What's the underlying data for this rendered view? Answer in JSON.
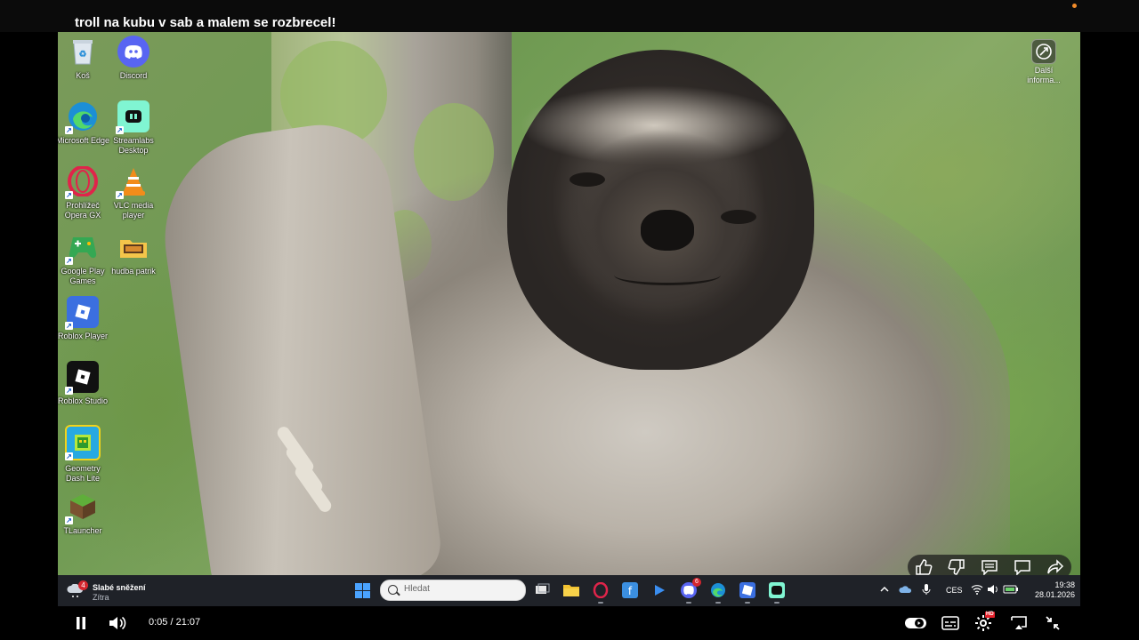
{
  "video": {
    "title": "troll na kubu v sab a malem se rozbrecel!"
  },
  "desktop": {
    "icons": [
      {
        "label": "Koš",
        "icon": "recycle-bin-icon"
      },
      {
        "label": "Discord",
        "icon": "discord-icon"
      },
      {
        "label": "Microsoft Edge",
        "icon": "edge-icon"
      },
      {
        "label": "Streamlabs Desktop",
        "icon": "streamlabs-icon"
      },
      {
        "label": "Prohlížeč Opera GX",
        "icon": "opera-gx-icon"
      },
      {
        "label": "VLC media player",
        "icon": "vlc-icon"
      },
      {
        "label": "Google Play Games",
        "icon": "google-play-games-icon"
      },
      {
        "label": "hudba patrik",
        "icon": "folder-icon"
      },
      {
        "label": "Roblox Player",
        "icon": "roblox-player-icon"
      },
      {
        "label": "Roblox Studio",
        "icon": "roblox-studio-icon"
      },
      {
        "label": "Geometry Dash Lite",
        "icon": "geometry-dash-icon"
      },
      {
        "label": "TLauncher",
        "icon": "tlauncher-icon"
      }
    ],
    "more_info": "Další informa..."
  },
  "taskbar": {
    "weather_title": "Slabé sněžení",
    "weather_sub": "Zítra",
    "weather_badge": "4",
    "search_placeholder": "Hledat",
    "discord_badge": "6",
    "language": "CES",
    "time": "19:38",
    "date": "28.01.2026",
    "apps": [
      "task-view-icon",
      "file-explorer-icon",
      "opera-gx-icon",
      "files-icon",
      "media-icon",
      "discord-icon",
      "edge-icon",
      "roblox-icon",
      "streamlabs-icon"
    ]
  },
  "player": {
    "time_display": "0:05 / 21:07",
    "hd_badge": "HD",
    "reactions": [
      "like-icon",
      "dislike-icon",
      "comments-icon",
      "chat-icon",
      "share-icon"
    ]
  }
}
